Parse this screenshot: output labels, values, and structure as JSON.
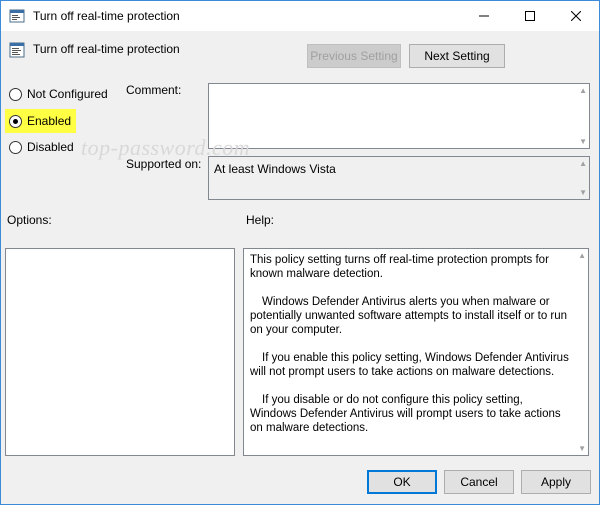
{
  "window": {
    "title": "Turn off real-time protection",
    "icon": "policy-icon",
    "controls": {
      "minimize": "—",
      "maximize": "☐",
      "close": "✕"
    }
  },
  "header": {
    "policy_name": "Turn off real-time protection",
    "previous_setting_label": "Previous Setting",
    "next_setting_label": "Next Setting"
  },
  "state": {
    "options": [
      {
        "label": "Not Configured",
        "selected": false
      },
      {
        "label": "Enabled",
        "selected": true
      },
      {
        "label": "Disabled",
        "selected": false
      }
    ]
  },
  "comment": {
    "label": "Comment:",
    "value": ""
  },
  "supported_on": {
    "label": "Supported on:",
    "value": "At least Windows Vista"
  },
  "watermark": "top-password.com",
  "options_panel": {
    "label": "Options:"
  },
  "help_panel": {
    "label": "Help:",
    "paragraphs": [
      "This policy setting turns off real-time protection prompts for known malware detection.",
      "Windows Defender Antivirus alerts you when malware or potentially unwanted software attempts to install itself or to run on your computer.",
      "If you enable this policy setting, Windows Defender Antivirus will not prompt users to take actions on malware detections.",
      "If you disable or do not configure this policy setting, Windows Defender Antivirus will prompt users to take actions on malware detections."
    ]
  },
  "footer": {
    "ok_label": "OK",
    "cancel_label": "Cancel",
    "apply_label": "Apply"
  },
  "colors": {
    "accent": "#0078d7",
    "highlight": "#ffff44",
    "border": "#3c8bd9"
  }
}
